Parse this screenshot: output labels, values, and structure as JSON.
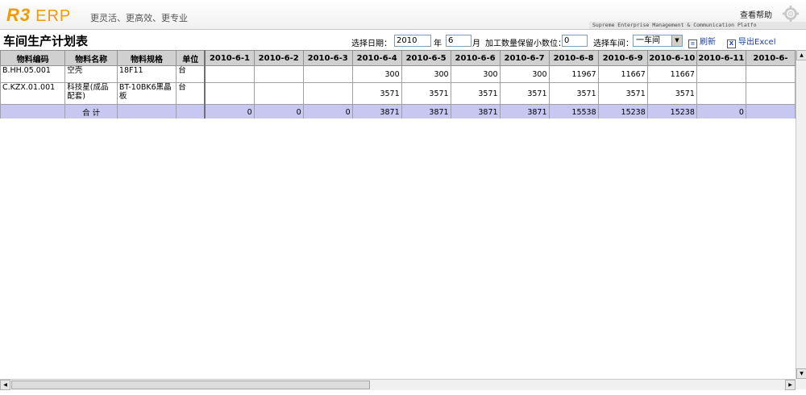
{
  "header": {
    "logo_r3": "R3",
    "logo_erp": "ERP",
    "slogan": "更灵活、更高效、更专业",
    "help": "查看帮助",
    "tagline": "Supreme Enterprise Management & Communication Platfo"
  },
  "toolbar": {
    "title": "车间生产计划表",
    "date_label": "选择日期：",
    "year_value": "2010",
    "year_unit": "年",
    "month_value": "6",
    "month_unit": "月",
    "decimal_label": "加工数量保留小数位：",
    "decimal_value": "0",
    "workshop_label": "选择车间：",
    "workshop_value": "一车间",
    "refresh": "刷新",
    "export": "导出Excel"
  },
  "table": {
    "fixed_headers": [
      "物料编码",
      "物料名称",
      "物料规格",
      "单位"
    ],
    "date_headers": [
      "2010-6-1",
      "2010-6-2",
      "2010-6-3",
      "2010-6-4",
      "2010-6-5",
      "2010-6-6",
      "2010-6-7",
      "2010-6-8",
      "2010-6-9",
      "2010-6-10",
      "2010-6-11",
      "2010-6-"
    ],
    "rows": [
      {
        "code": "B.HH.05.001",
        "name": "空壳",
        "spec": "18F11",
        "unit": "台",
        "values": [
          "",
          "",
          "",
          "300",
          "300",
          "300",
          "300",
          "11967",
          "11667",
          "11667",
          "",
          ""
        ]
      },
      {
        "code": "C.KZX.01.001",
        "name": "科技星(成品配套)",
        "spec": "BT-10BK6黑晶板",
        "unit": "台",
        "values": [
          "",
          "",
          "",
          "3571",
          "3571",
          "3571",
          "3571",
          "3571",
          "3571",
          "3571",
          "",
          ""
        ]
      }
    ],
    "total": {
      "label": "合 计",
      "values": [
        "0",
        "0",
        "0",
        "3871",
        "3871",
        "3871",
        "3871",
        "15538",
        "15238",
        "15238",
        "0",
        ""
      ]
    }
  },
  "icons": {
    "gear": "gear-icon",
    "refresh": "refresh-icon",
    "export": "excel-icon",
    "dropdown": "chevron-down-icon"
  }
}
